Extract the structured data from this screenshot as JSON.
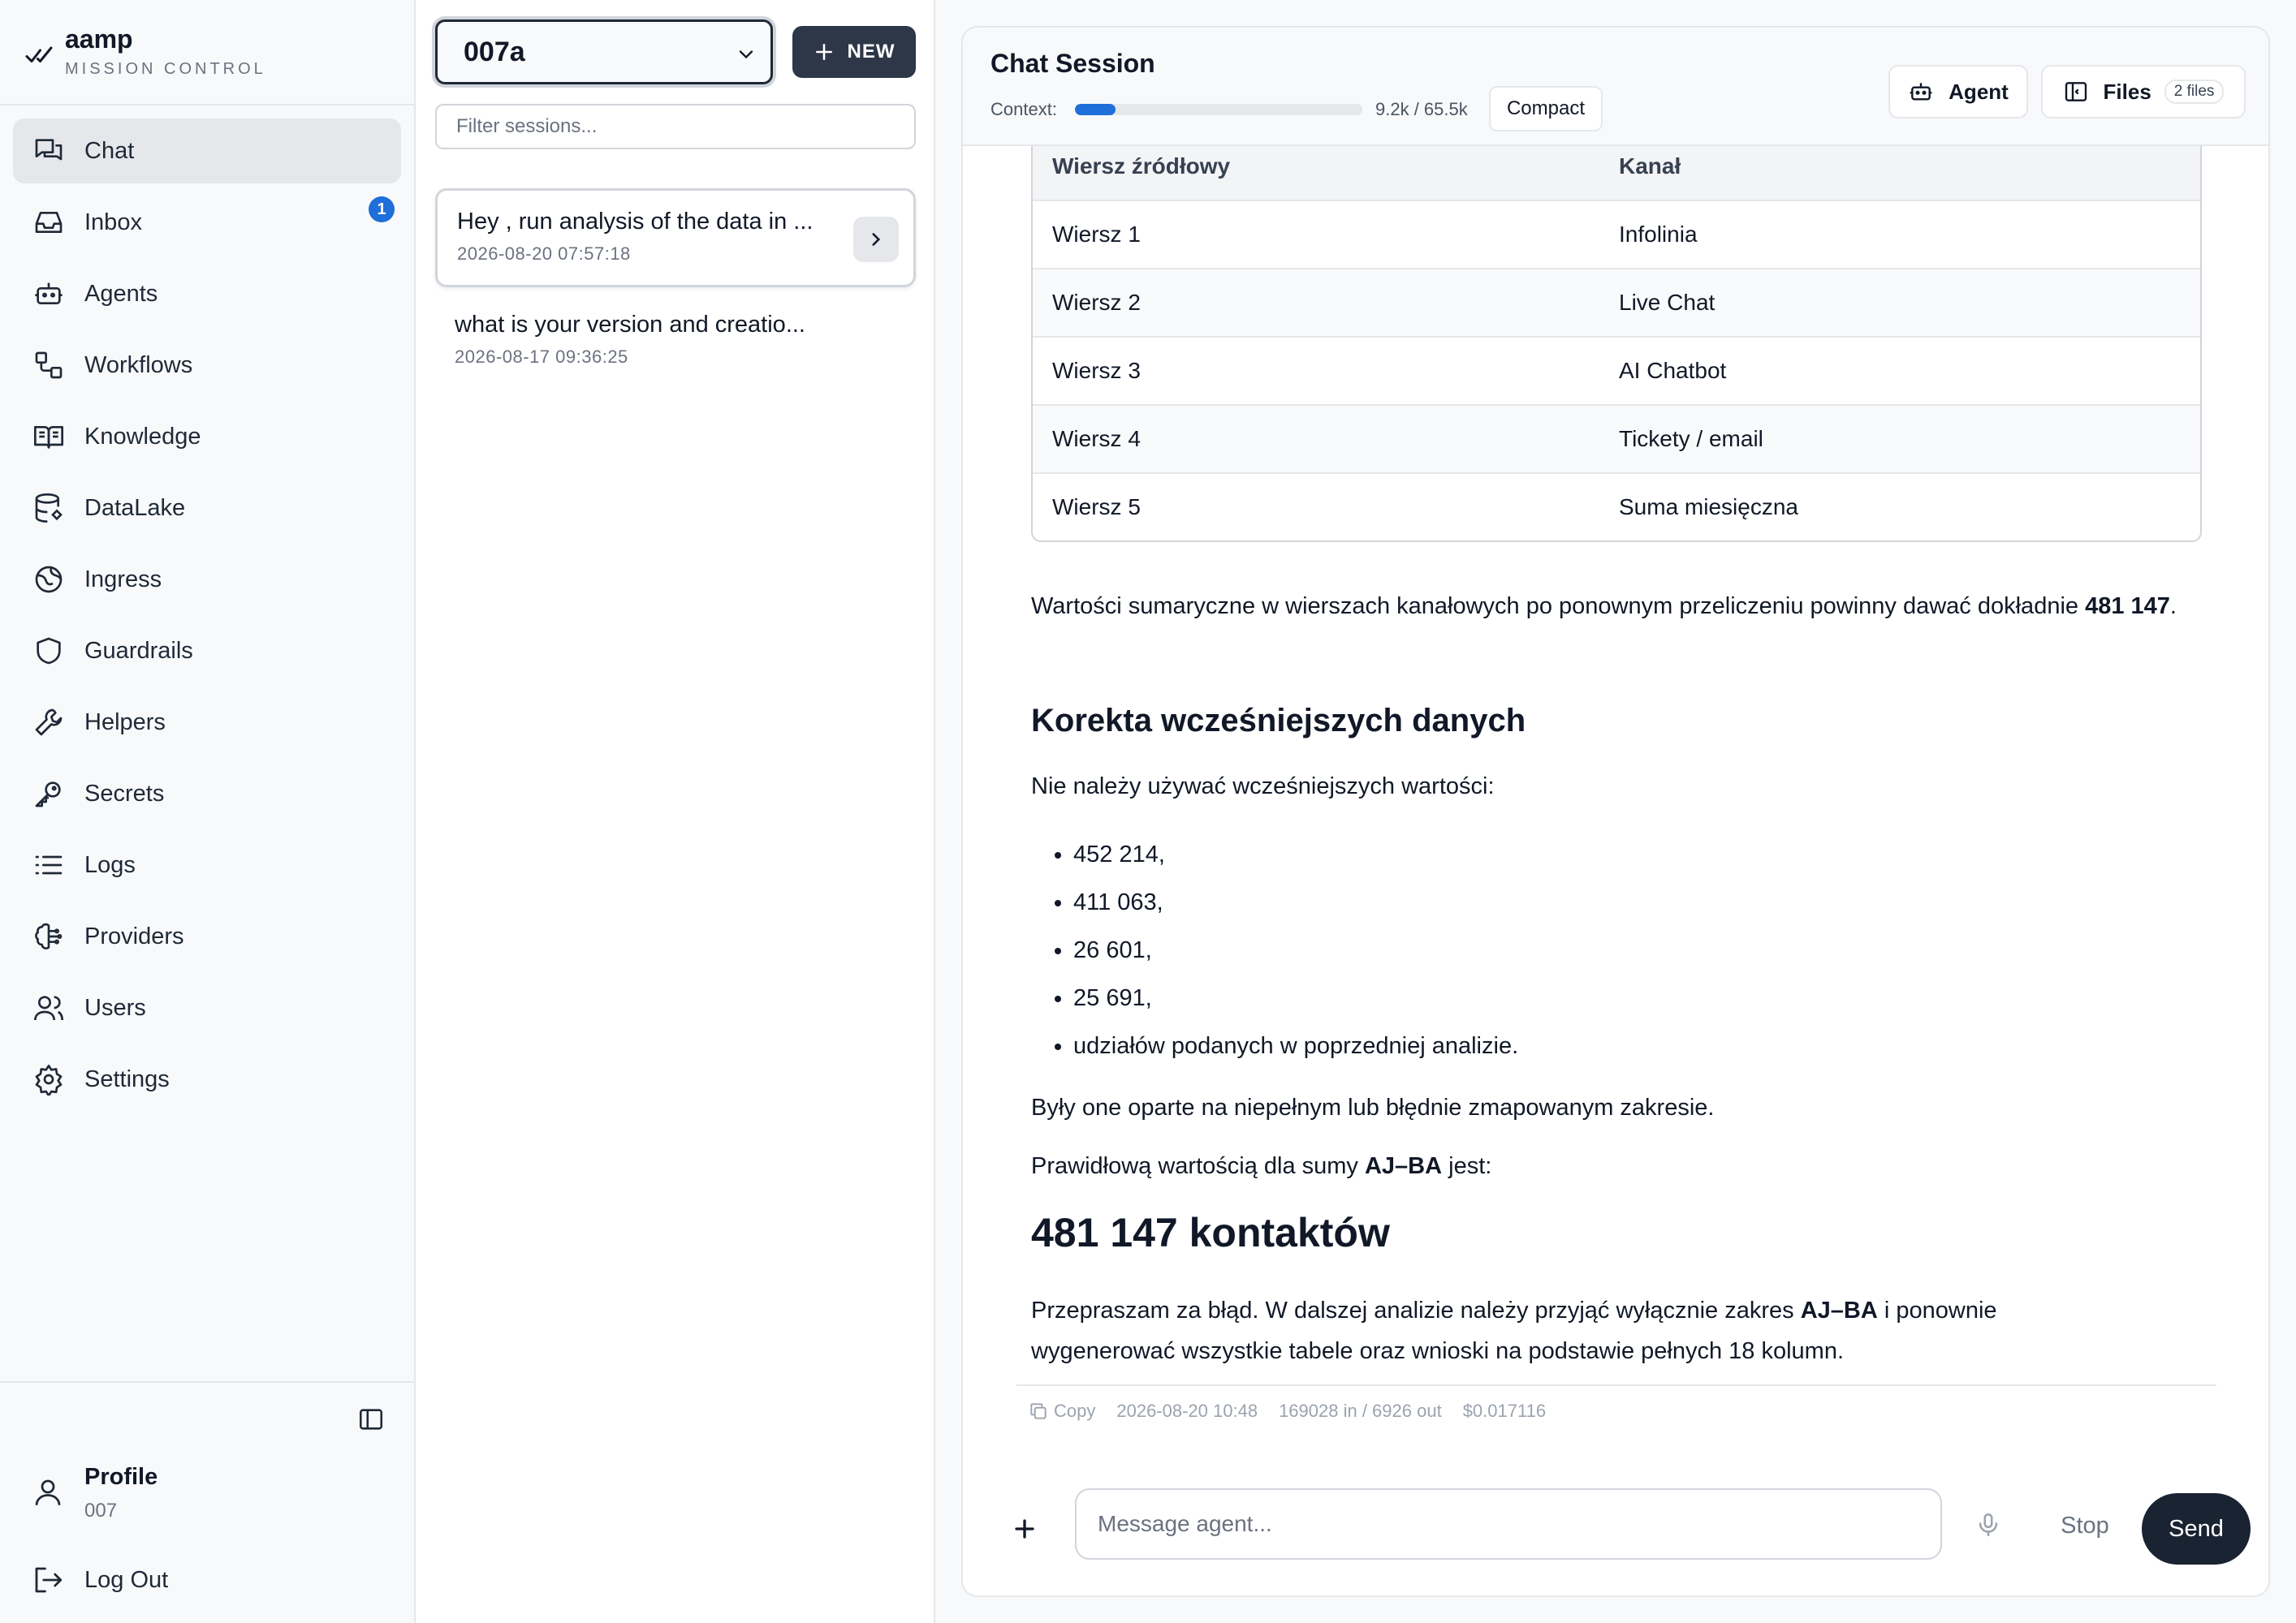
{
  "brand": {
    "name": "aamp",
    "subtitle": "MISSION CONTROL"
  },
  "sidebar": {
    "items": [
      {
        "label": "Chat",
        "icon": "chat-icon"
      },
      {
        "label": "Inbox",
        "icon": "inbox-icon",
        "badge": "1"
      },
      {
        "label": "Agents",
        "icon": "agent-bot-icon"
      },
      {
        "label": "Workflows",
        "icon": "workflow-icon"
      },
      {
        "label": "Knowledge",
        "icon": "book-icon"
      },
      {
        "label": "DataLake",
        "icon": "database-icon"
      },
      {
        "label": "Ingress",
        "icon": "globe-icon"
      },
      {
        "label": "Guardrails",
        "icon": "shield-icon"
      },
      {
        "label": "Helpers",
        "icon": "wrench-icon"
      },
      {
        "label": "Secrets",
        "icon": "key-icon"
      },
      {
        "label": "Logs",
        "icon": "list-icon"
      },
      {
        "label": "Providers",
        "icon": "brain-icon"
      },
      {
        "label": "Users",
        "icon": "users-icon"
      },
      {
        "label": "Settings",
        "icon": "gear-icon"
      }
    ],
    "profile": {
      "name": "Profile",
      "sub": "007"
    },
    "logout_label": "Log Out"
  },
  "sessions": {
    "selected": "007a",
    "new_label": "NEW",
    "filter_placeholder": "Filter sessions...",
    "list": [
      {
        "title": "Hey , run analysis of the data in ...",
        "time": "2026-08-20 07:57:18"
      },
      {
        "title": "what is your version and creatio...",
        "time": "2026-08-17 09:36:25"
      }
    ]
  },
  "chat": {
    "title": "Chat Session",
    "context_label": "Context:",
    "context_value": "9.2k / 65.5k",
    "context_fraction": 0.14,
    "compact_label": "Compact",
    "agent_label": "Agent",
    "files_label": "Files",
    "files_count": "2 files",
    "table": {
      "headers": [
        "Wiersz źródłowy",
        "Kanał"
      ],
      "rows": [
        [
          "Wiersz 1",
          "Infolinia"
        ],
        [
          "Wiersz 2",
          "Live Chat"
        ],
        [
          "Wiersz 3",
          "AI Chatbot"
        ],
        [
          "Wiersz 4",
          "Tickety / email"
        ],
        [
          "Wiersz 5",
          "Suma miesięczna"
        ]
      ]
    },
    "p1_text": "Wartości sumaryczne w wierszach kanałowych po ponownym przeliczeniu powinny dawać dokładnie ",
    "p1_bold": "481 147",
    "p1_end": ".",
    "h_correction": "Korekta wcześniejszych danych",
    "p2": "Nie należy używać wcześniejszych wartości:",
    "bullets": [
      "452 214,",
      "411 063,",
      "26 601,",
      "25 691,",
      "udziałów podanych w poprzedniej analizie."
    ],
    "p3": "Były one oparte na niepełnym lub błędnie zmapowanym zakresie.",
    "p4_text": "Prawidłową wartością dla sumy ",
    "p4_bold": "AJ–BA",
    "p4_end": " jest:",
    "h_total": "481 147 kontaktów",
    "p5_text": "Przepraszam za błąd. W dalszej analizie należy przyjąć wyłącznie zakres ",
    "p5_bold": "AJ–BA",
    "p5_end": " i ponownie wygenerować wszystkie tabele oraz wnioski na podstawie pełnych 18 kolumn.",
    "meta": {
      "copy_label": "Copy",
      "timestamp": "2026-08-20 10:48",
      "tokens": "169028 in / 6926 out",
      "cost": "$0.017116"
    },
    "input_placeholder": "Message agent...",
    "stop_label": "Stop",
    "send_label": "Send"
  }
}
